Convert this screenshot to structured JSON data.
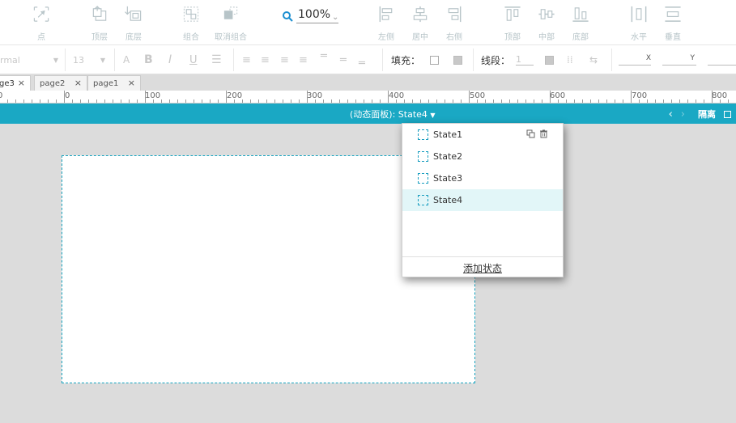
{
  "toolbar": {
    "point_label": "点",
    "top_label": "顶层",
    "bottom_label": "底层",
    "group_label": "组合",
    "ungroup_label": "取消组合",
    "zoom_value": "100%",
    "align_left_label": "左侧",
    "align_center_label": "居中",
    "align_right_label": "右侧",
    "align_top_label": "顶部",
    "align_middle_label": "中部",
    "align_bottom_label": "底部",
    "distribute_h_label": "水平",
    "distribute_v_label": "垂直"
  },
  "format": {
    "font_style": "rmal",
    "font_size": "13",
    "fill_label": "填充：",
    "stroke_label": "线段：",
    "stroke_width": "1",
    "x_label": "X",
    "y_label": "Y"
  },
  "tabs": [
    {
      "label": "ge3"
    },
    {
      "label": "page2"
    },
    {
      "label": "page1"
    }
  ],
  "ruler_labels": [
    "0",
    "0",
    "100",
    "200",
    "300",
    "400",
    "500",
    "600",
    "700",
    "800"
  ],
  "statebar": {
    "prefix": "(动态面板):",
    "current_state": "State4",
    "isolate_label": "隔离"
  },
  "states": [
    {
      "label": "State1"
    },
    {
      "label": "State2"
    },
    {
      "label": "State3"
    },
    {
      "label": "State4"
    }
  ],
  "add_state_label": "添加状态",
  "colors": {
    "accent": "#1aa8c4",
    "selected_row": "#e2f6f8"
  }
}
